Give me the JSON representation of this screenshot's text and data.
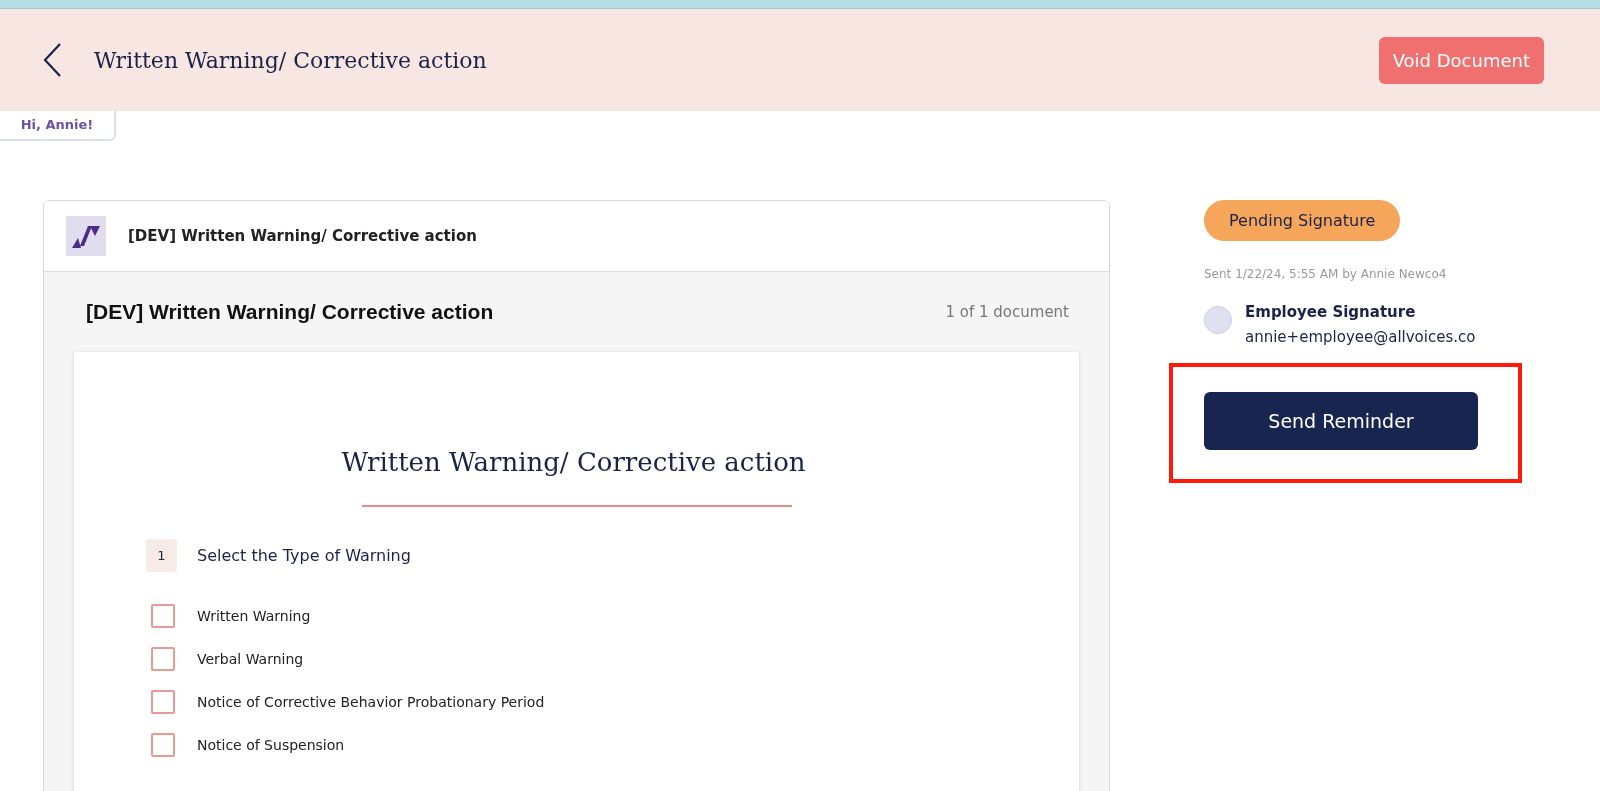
{
  "header": {
    "title": "Written Warning/ Corrective action",
    "void_button": "Void Document"
  },
  "greeting": "Hi, Annie!",
  "document_viewer": {
    "header_title": "[DEV] Written Warning/ Corrective action",
    "title": "[DEV] Written Warning/ Corrective action",
    "page_count": "1 of 1 document",
    "page": {
      "title": "Written Warning/ Corrective action",
      "question": {
        "number": "1",
        "label": "Select the Type of Warning",
        "options": [
          {
            "label": "Written Warning",
            "checked": false
          },
          {
            "label": "Verbal Warning",
            "checked": false
          },
          {
            "label": "Notice of Corrective Behavior Probationary Period",
            "checked": false
          },
          {
            "label": "Notice of Suspension",
            "checked": false
          }
        ]
      }
    }
  },
  "status_panel": {
    "status": "Pending Signature",
    "sent_info": "Sent 1/22/24, 5:55 AM by Annie Newco4",
    "signers": [
      {
        "role": "Employee Signature",
        "email": "annie+employee@allvoices.co",
        "signed": false
      }
    ],
    "reminder_button": "Send Reminder",
    "highlighted": true
  }
}
